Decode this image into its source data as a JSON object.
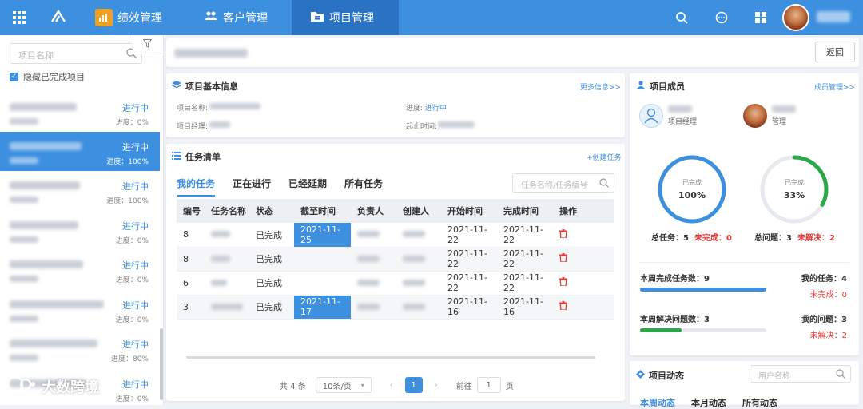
{
  "topbar": {
    "nav": [
      {
        "label": "绩效管理",
        "icon": "chart-icon"
      },
      {
        "label": "客户管理",
        "icon": "users-icon"
      },
      {
        "label": "项目管理",
        "icon": "folder-icon"
      }
    ]
  },
  "sidebar": {
    "search_placeholder": "项目名称",
    "hide_completed_label": "隐藏已完成项目",
    "projects": [
      {
        "status": "进行中",
        "progress": "进度：0%"
      },
      {
        "status": "进行中",
        "progress": "进度：100%"
      },
      {
        "status": "进行中",
        "progress": "进度：100%"
      },
      {
        "status": "进行中",
        "progress": "进度：0%"
      },
      {
        "status": "进行中",
        "progress": "进度：0%"
      },
      {
        "status": "进行中",
        "progress": "进度：0%"
      },
      {
        "status": "进行中",
        "progress": "进度：80%"
      },
      {
        "status": "进行中",
        "progress": "进度：0%"
      }
    ],
    "watermark": "大数跨境"
  },
  "header": {
    "back_label": "返回"
  },
  "basic_info": {
    "title": "项目基本信息",
    "more_link": "更多信息>>",
    "name_label": "项目名称:",
    "manager_label": "项目经理:",
    "progress_label": "进度:",
    "progress_value": "进行中",
    "period_label": "起止时间:"
  },
  "tasks": {
    "title": "任务清单",
    "create_link": "+创建任务",
    "tabs": [
      "我的任务",
      "正在进行",
      "已经延期",
      "所有任务"
    ],
    "search_placeholder": "任务名称/任务编号",
    "columns": [
      "编号",
      "任务名称",
      "状态",
      "截至时间",
      "负责人",
      "创建人",
      "开始时间",
      "完成时间",
      "操作"
    ],
    "rows": [
      {
        "id": "8",
        "status": "已完成",
        "deadline": "2021-11-25",
        "start": "2021-11-22",
        "finish": "2021-11-22"
      },
      {
        "id": "8",
        "status": "已完成",
        "deadline": "",
        "start": "2021-11-22",
        "finish": "2021-11-22"
      },
      {
        "id": "6",
        "status": "已完成",
        "deadline": "",
        "start": "2021-11-22",
        "finish": "2021-11-22"
      },
      {
        "id": "3",
        "status": "已完成",
        "deadline": "2021-11-17",
        "start": "2021-11-16",
        "finish": "2021-11-16"
      }
    ],
    "pager": {
      "total": "共 4 条",
      "page_size": "10条/页",
      "prev": "‹",
      "current": "1",
      "next": "›",
      "goto_label": "前往",
      "goto_value": "1",
      "page_unit": "页"
    }
  },
  "members": {
    "title": "项目成员",
    "manage_link": "成员管理>>",
    "list": [
      {
        "role": "项目经理"
      },
      {
        "role": "管理"
      }
    ],
    "task_ring": {
      "label": "已完成",
      "value": "100%",
      "fraction": 1.0,
      "color": "#3d8fe0"
    },
    "issue_ring": {
      "label": "已完成",
      "value": "33%",
      "fraction": 0.33,
      "color": "#2aa84a"
    },
    "total_tasks_label": "总任务：",
    "total_tasks_value": "5",
    "unfinished_label": "未完成：",
    "unfinished_value": "0",
    "total_issues_label": "总问题：",
    "total_issues_value": "3",
    "unresolved_label": "未解决：",
    "unresolved_value": "2",
    "week_done_label": "本周完成任务数：",
    "week_done_value": "9",
    "week_done_fraction": 1.0,
    "my_tasks_label": "我的任务：",
    "my_tasks_value": "4",
    "my_unfinished_label": "未完成：",
    "my_unfinished_value": "0",
    "week_solved_label": "本周解决问题数：",
    "week_solved_value": "3",
    "week_solved_fraction": 0.33,
    "my_issues_label": "我的问题：",
    "my_issues_value": "3",
    "my_unresolved_label": "未解决：",
    "my_unresolved_value": "2"
  },
  "activity": {
    "title": "项目动态",
    "search_placeholder": "用户名称",
    "tabs": [
      "本周动态",
      "本月动态",
      "所有动态"
    ]
  }
}
